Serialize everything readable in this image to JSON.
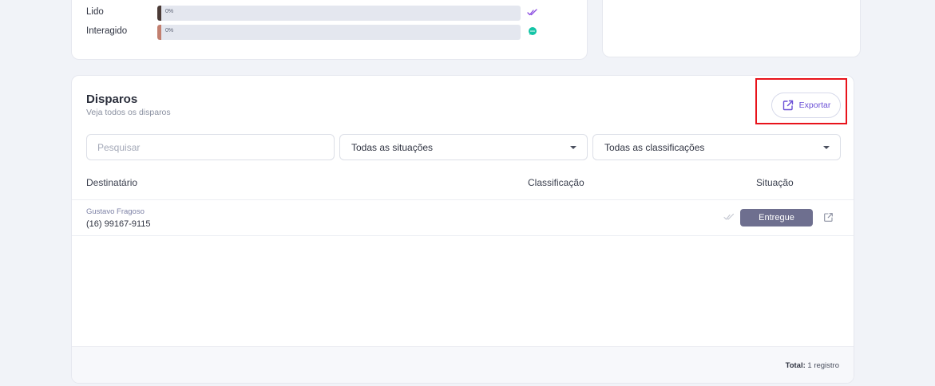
{
  "stats": {
    "rows": [
      {
        "label": "Lido",
        "percent": "0%",
        "fill_color": "#4a3a36",
        "icon": "double-check-icon",
        "icon_color": "#8a4be0"
      },
      {
        "label": "Interagido",
        "percent": "0%",
        "fill_color": "#c27f6f",
        "icon": "chat-bubble-icon",
        "icon_color": "#14c4a6"
      }
    ]
  },
  "disparos": {
    "title": "Disparos",
    "subtitle": "Veja todos os disparos",
    "export_label": "Exportar",
    "search_placeholder": "Pesquisar",
    "situations_filter": "Todas as situações",
    "classifications_filter": "Todas as classificações",
    "columns": {
      "recipient": "Destinatário",
      "classification": "Classificação",
      "situation": "Situação"
    },
    "rows": [
      {
        "name": "Gustavo Fragoso",
        "phone": "(16) 99167-9115",
        "classification": "",
        "status": "Entregue"
      }
    ],
    "footer": {
      "total_label": "Total:",
      "total_value": "1 registro"
    }
  },
  "colors": {
    "accent": "#6a4fd6",
    "status_badge": "#6e6f8f",
    "highlight": "#e8131b"
  }
}
